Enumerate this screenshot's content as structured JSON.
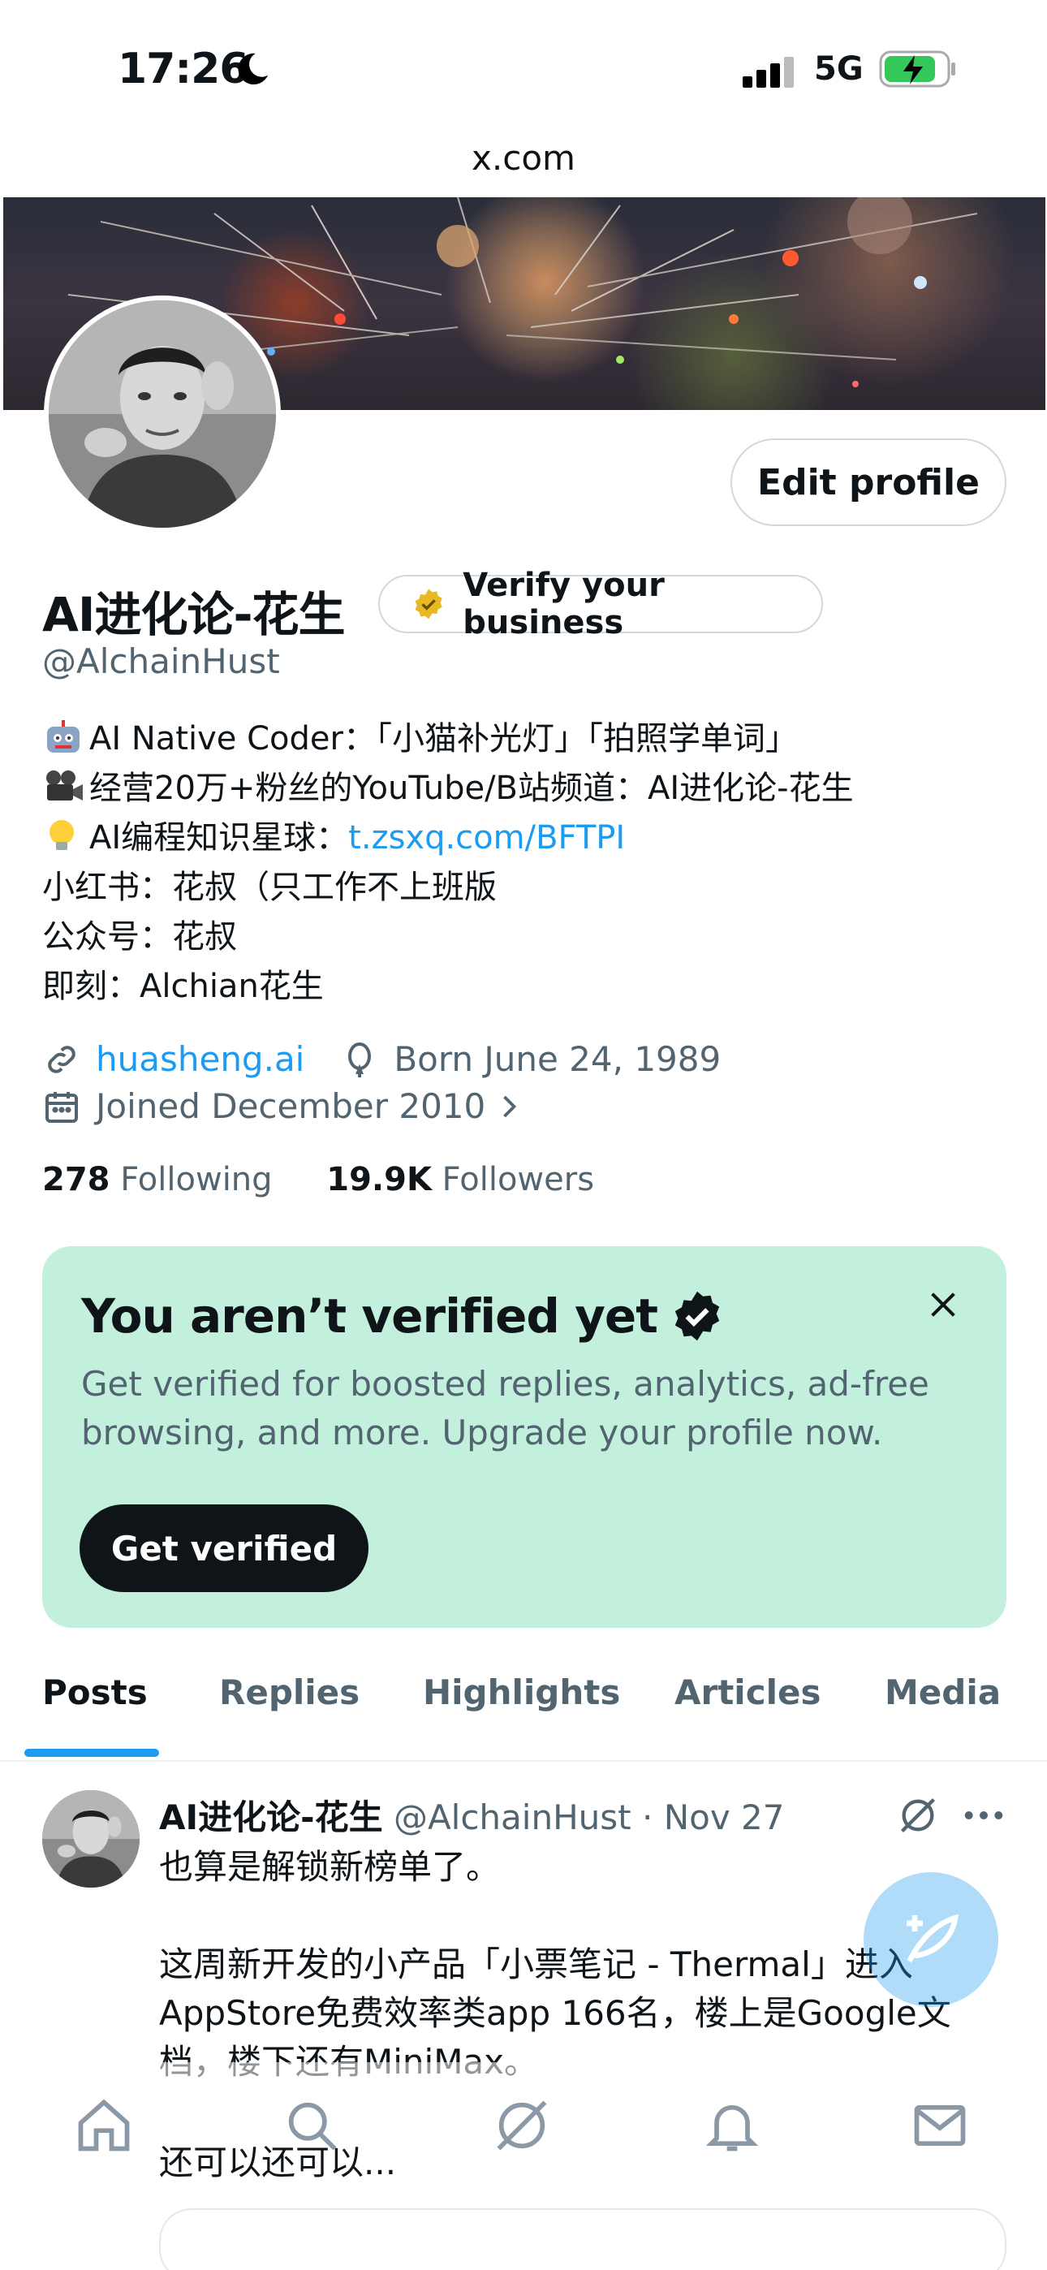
{
  "status_bar": {
    "time": "17:26",
    "network": "5G"
  },
  "browser": {
    "url": "x.com"
  },
  "profile": {
    "edit_label": "Edit profile",
    "name": "AI进化论-花生",
    "verify_business_label": "Verify your business",
    "handle": "@AlchainHust",
    "bio": {
      "line1_emoji": "robot-emoji",
      "line1": "AI Native Coder：「小猫补光灯」「拍照学单词」",
      "line2_emoji": "movie-camera-emoji",
      "line2": "经营20万+粉丝的YouTube/B站频道：AI进化论-花生",
      "line3_emoji": "light-bulb-emoji",
      "line3_prefix": "AI编程知识星球：",
      "line3_link": "t.zsxq.com/BFTPI",
      "line4": "小红书：花叔（只工作不上班版",
      "line5": "公众号：花叔",
      "line6": "即刻：Alchian花生"
    },
    "website": "huasheng.ai",
    "born": "Born June 24, 1989",
    "joined": "Joined December 2010",
    "following_count": "278",
    "following_label": "Following",
    "followers_count": "19.9K",
    "followers_label": "Followers"
  },
  "verify_card": {
    "title": "You aren’t verified yet",
    "description": "Get verified for boosted replies, analytics, ad-free browsing, and more. Upgrade your profile now.",
    "button": "Get verified"
  },
  "tabs": [
    {
      "label": "Posts",
      "active": true
    },
    {
      "label": "Replies",
      "active": false
    },
    {
      "label": "Highlights",
      "active": false
    },
    {
      "label": "Articles",
      "active": false
    },
    {
      "label": "Media",
      "active": false
    }
  ],
  "post": {
    "name": "AI进化论-花生",
    "handle": "@AlchainHust",
    "date": "Nov 27",
    "line1": "也算是解锁新榜单了。",
    "line2": "这周新开发的小产品「小票笔记 - Thermal」进入AppStore免费效率类app 166名，楼上是Google文档，楼下还有MiniMax。",
    "line3": "还可以还可以..."
  },
  "colors": {
    "accent": "#1d9bf0",
    "card_bg": "#c2f0dc",
    "text": "#0f1419",
    "muted": "#536471"
  },
  "nav": [
    "home-icon",
    "search-icon",
    "grok-icon",
    "bell-icon",
    "mail-icon"
  ]
}
